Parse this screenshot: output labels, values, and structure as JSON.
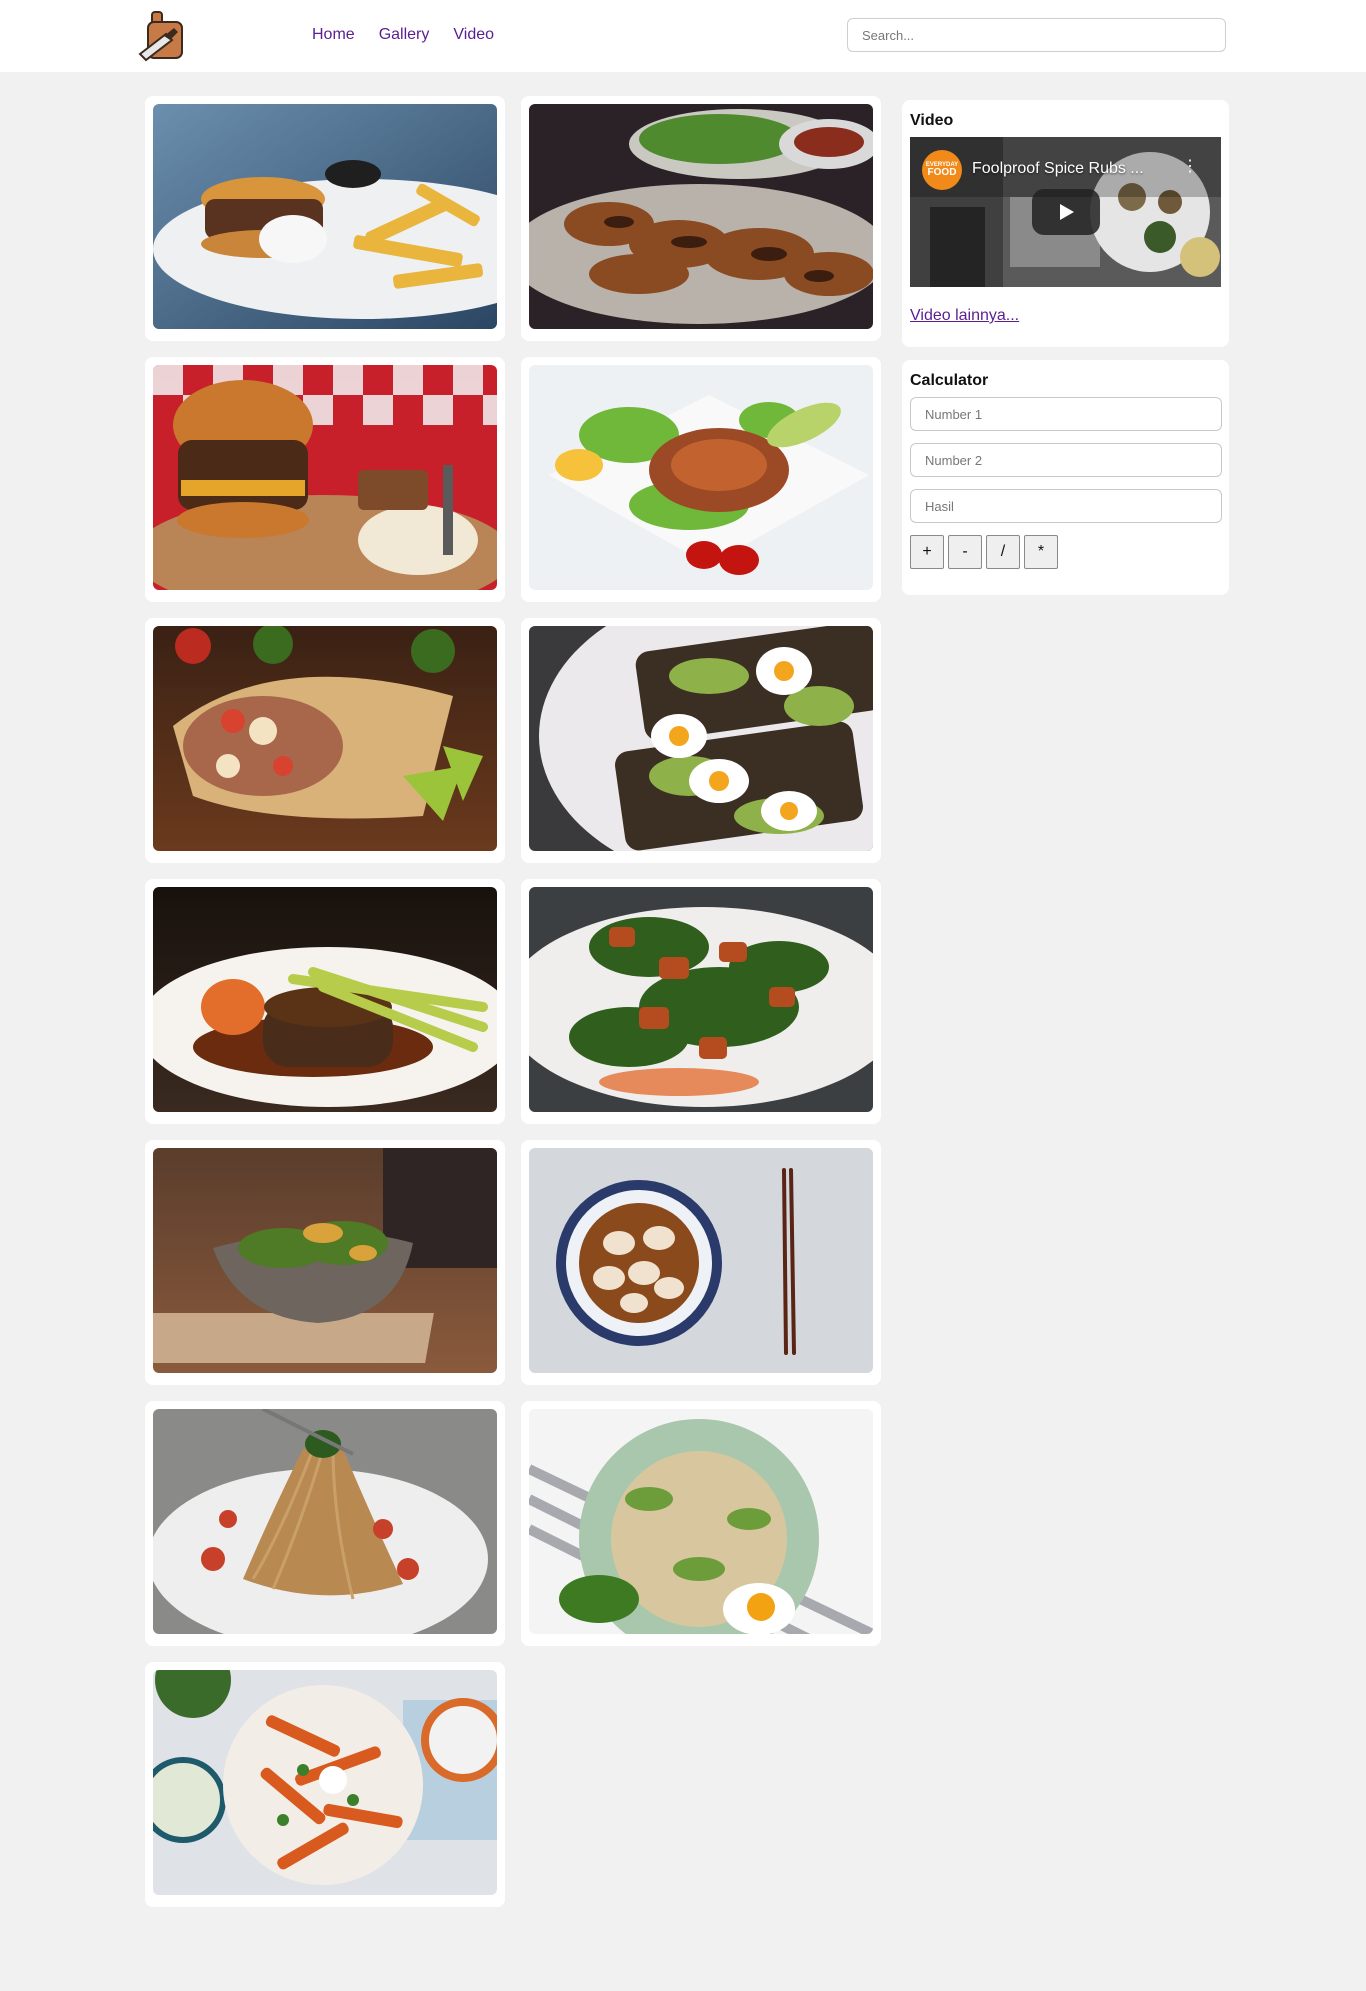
{
  "header": {
    "logo_icon": "cutting-board-knife-icon",
    "nav": [
      {
        "label": "Home"
      },
      {
        "label": "Gallery"
      },
      {
        "label": "Video"
      }
    ],
    "search_placeholder": "Search...",
    "link_color": "#5b1f8f"
  },
  "gallery": {
    "items": [
      {
        "subject": "burger-and-fries"
      },
      {
        "subject": "grilled-chicken-skewers"
      },
      {
        "subject": "burger-on-wooden-board"
      },
      {
        "subject": "salmon-steak-salad"
      },
      {
        "subject": "burrito-wrap"
      },
      {
        "subject": "avocado-egg-toast"
      },
      {
        "subject": "steak-with-asparagus"
      },
      {
        "subject": "chicken-spinach-salad"
      },
      {
        "subject": "salad-bowl"
      },
      {
        "subject": "dumpling-soup-chopsticks"
      },
      {
        "subject": "spaghetti-on-fork"
      },
      {
        "subject": "rice-bowl-with-egg"
      },
      {
        "subject": "sweet-potato-fries-platter"
      }
    ]
  },
  "video_panel": {
    "heading": "Video",
    "channel_badge_top": "EVERYDAY",
    "channel_badge_bottom": "FOOD",
    "video_title": "Foolproof Spice Rubs ...",
    "more_link": "Video lainnya..."
  },
  "calculator": {
    "heading": "Calculator",
    "number1_placeholder": "Number 1",
    "number2_placeholder": "Number 2",
    "result_placeholder": "Hasil",
    "ops": [
      "+",
      "-",
      "/",
      "*"
    ]
  }
}
